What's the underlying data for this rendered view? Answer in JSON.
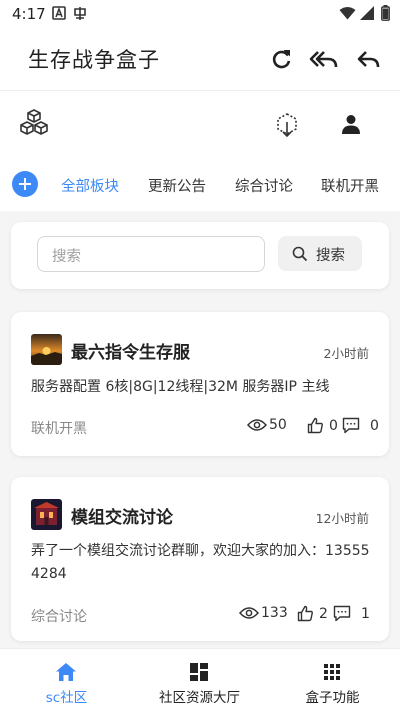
{
  "status_bar": {
    "time": "4:17",
    "icons": [
      "a-box-icon",
      "app-notification-icon",
      "wifi-icon",
      "cellular-icon",
      "battery-icon"
    ]
  },
  "app_bar": {
    "title": "生存战争盒子",
    "actions": [
      "refresh-icon",
      "reply-all-icon",
      "reply-icon"
    ]
  },
  "toolbar": {
    "icons": [
      "cubes-icon",
      "export-cube-icon",
      "user-icon"
    ]
  },
  "tabs": {
    "add_icon": "plus-icon",
    "items": [
      {
        "label": "全部板块",
        "active": true
      },
      {
        "label": "更新公告",
        "active": false
      },
      {
        "label": "综合讨论",
        "active": false
      },
      {
        "label": "联机开黑",
        "active": false
      }
    ]
  },
  "search": {
    "placeholder": "搜索",
    "button_label": "搜索"
  },
  "posts": [
    {
      "title": "最六指令生存服",
      "time": "2小时前",
      "body": "服务器配置 6核|8G|12线程|32M 服务器IP 主线",
      "category": "联机开黑",
      "views": "50",
      "likes": "0",
      "comments": "0"
    },
    {
      "title": "模组交流讨论",
      "time": "12小时前",
      "body": "弄了一个模组交流讨论群聊，欢迎大家的加入：135554284",
      "category": "综合讨论",
      "views": "133",
      "likes": "2",
      "comments": "1"
    }
  ],
  "bottom_nav": {
    "items": [
      {
        "label": "sc社区",
        "icon": "home-icon",
        "active": true
      },
      {
        "label": "社区资源大厅",
        "icon": "dashboard-icon",
        "active": false
      },
      {
        "label": "盒子功能",
        "icon": "grid-icon",
        "active": false
      }
    ]
  },
  "colors": {
    "accent": "#3d8af7",
    "background": "#f5f5f5"
  }
}
